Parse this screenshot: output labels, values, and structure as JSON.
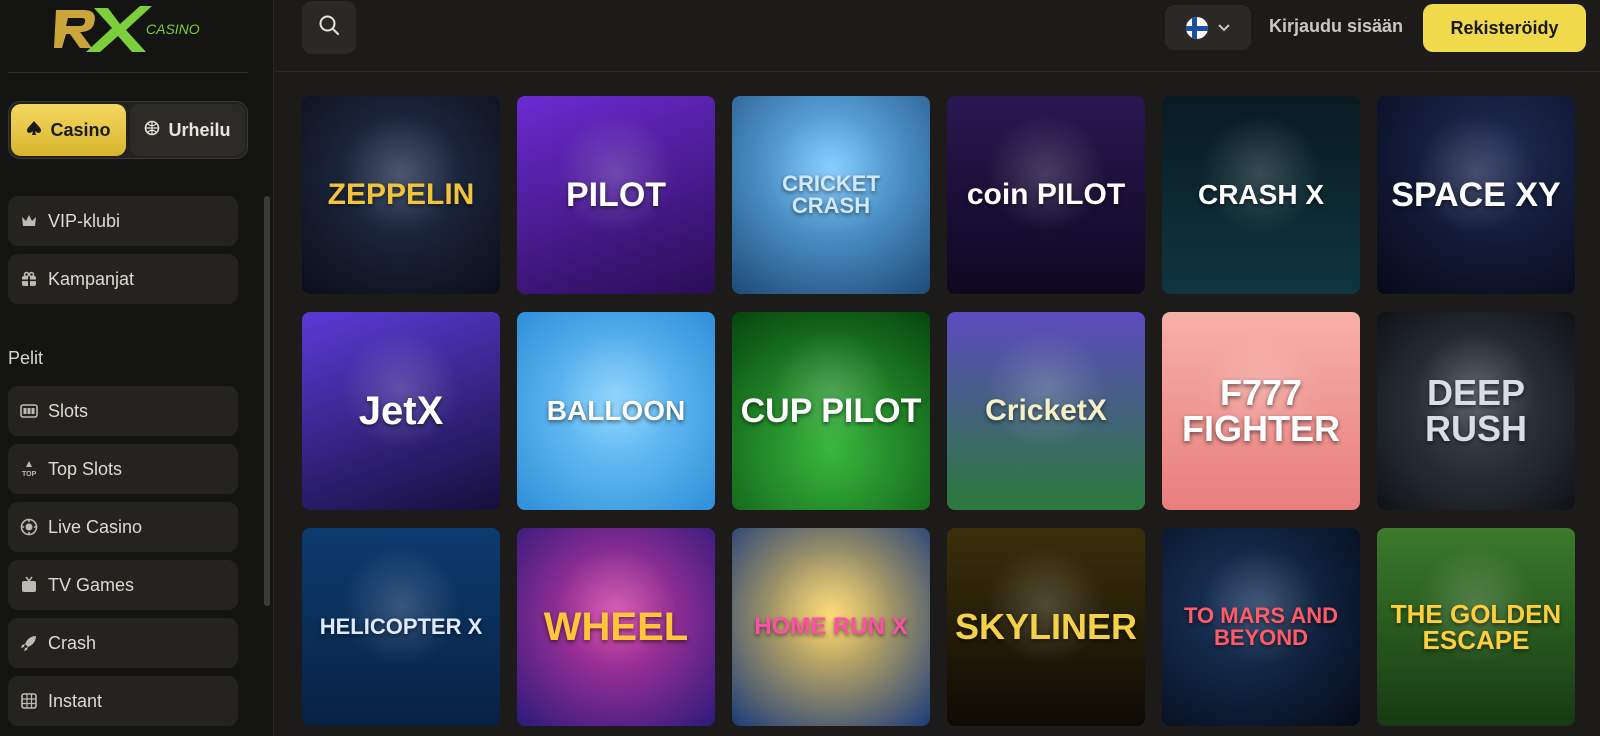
{
  "brand": {
    "logo_text": "RX",
    "logo_sub": "CASINO"
  },
  "mode_switch": {
    "casino": "Casino",
    "sports": "Urheilu"
  },
  "nav": {
    "vip": "VIP-klubi",
    "campaigns": "Kampanjat",
    "section_label": "Pelit",
    "items": [
      "Slots",
      "Top Slots",
      "Live Casino",
      "TV Games",
      "Crash",
      "Instant"
    ]
  },
  "header": {
    "login": "Kirjaudu sisään",
    "register": "Rekisteröidy",
    "language": "FI"
  },
  "games": [
    {
      "title": "ZEPPELIN",
      "bg": "#0f1420",
      "color": "#f2c43a"
    },
    {
      "title": "PILOT",
      "bg": "#3a1466",
      "color": "#ffffff"
    },
    {
      "title": "CRICKET CRASH",
      "bg": "#2f6f9c",
      "color": "#cfe9ff"
    },
    {
      "title": "coin PILOT",
      "bg": "#170e2e",
      "color": "#ffffff"
    },
    {
      "title": "CRASH X",
      "bg": "#07161c",
      "color": "#ffffff"
    },
    {
      "title": "SPACE XY",
      "bg": "#0b1226",
      "color": "#ffffff"
    },
    {
      "title": "JetX",
      "bg": "#1d1752",
      "color": "#ffffff"
    },
    {
      "title": "BALLOON",
      "bg": "#3aa8ea",
      "color": "#ffffff"
    },
    {
      "title": "CUP PILOT",
      "bg": "#0c6a1c",
      "color": "#ffffff"
    },
    {
      "title": "CricketX",
      "bg": "#3c2f78",
      "color": "#f6f0c9"
    },
    {
      "title": "F777 FIGHTER",
      "bg": "#f0a0a0",
      "color": "#ffffff"
    },
    {
      "title": "DEEP RUSH",
      "bg": "#1c1f26",
      "color": "#d8dde6"
    },
    {
      "title": "HELICOPTER X",
      "bg": "#0b2f5a",
      "color": "#dfe9ff"
    },
    {
      "title": "WHEEL",
      "bg": "#3a1f8a",
      "color": "#ffc53a"
    },
    {
      "title": "HOME RUN X",
      "bg": "#1c3f7a",
      "color": "#ff4fa8"
    },
    {
      "title": "SKYLINER",
      "bg": "#141007",
      "color": "#f3d24a"
    },
    {
      "title": "TO MARS AND BEYOND",
      "bg": "#08152a",
      "color": "#ff5a66"
    },
    {
      "title": "THE GOLDEN ESCAPE",
      "bg": "#1c4018",
      "color": "#ffcf3a"
    }
  ]
}
